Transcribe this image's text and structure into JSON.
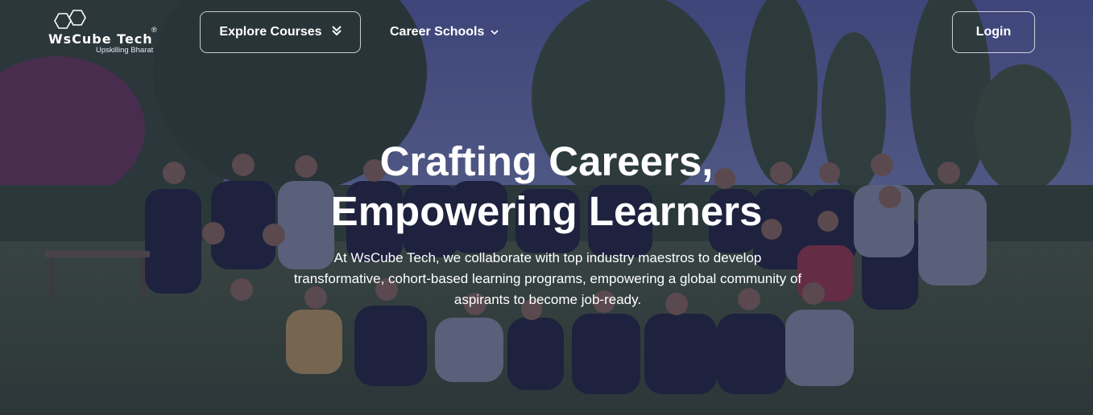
{
  "brand": {
    "name": "WsCube Tech",
    "registered": "®",
    "tagline": "Upskilling Bharat"
  },
  "nav": {
    "explore_label": "Explore Courses",
    "explore_icon": "double-chevron-down-icon",
    "career_label": "Career Schools",
    "career_icon": "chevron-down-icon",
    "login_label": "Login"
  },
  "hero": {
    "title_line1": "Crafting Careers,",
    "title_line2": "Empowering Learners",
    "description": "At WsCube Tech, we collaborate with top industry maestros to develop transformative, cohort-based learning programs, empowering a global community of aspirants to become job-ready.",
    "image": "team-group-photo"
  },
  "colors": {
    "overlay": "#191c46",
    "text": "#ffffff",
    "button_border": "#ffffff"
  }
}
